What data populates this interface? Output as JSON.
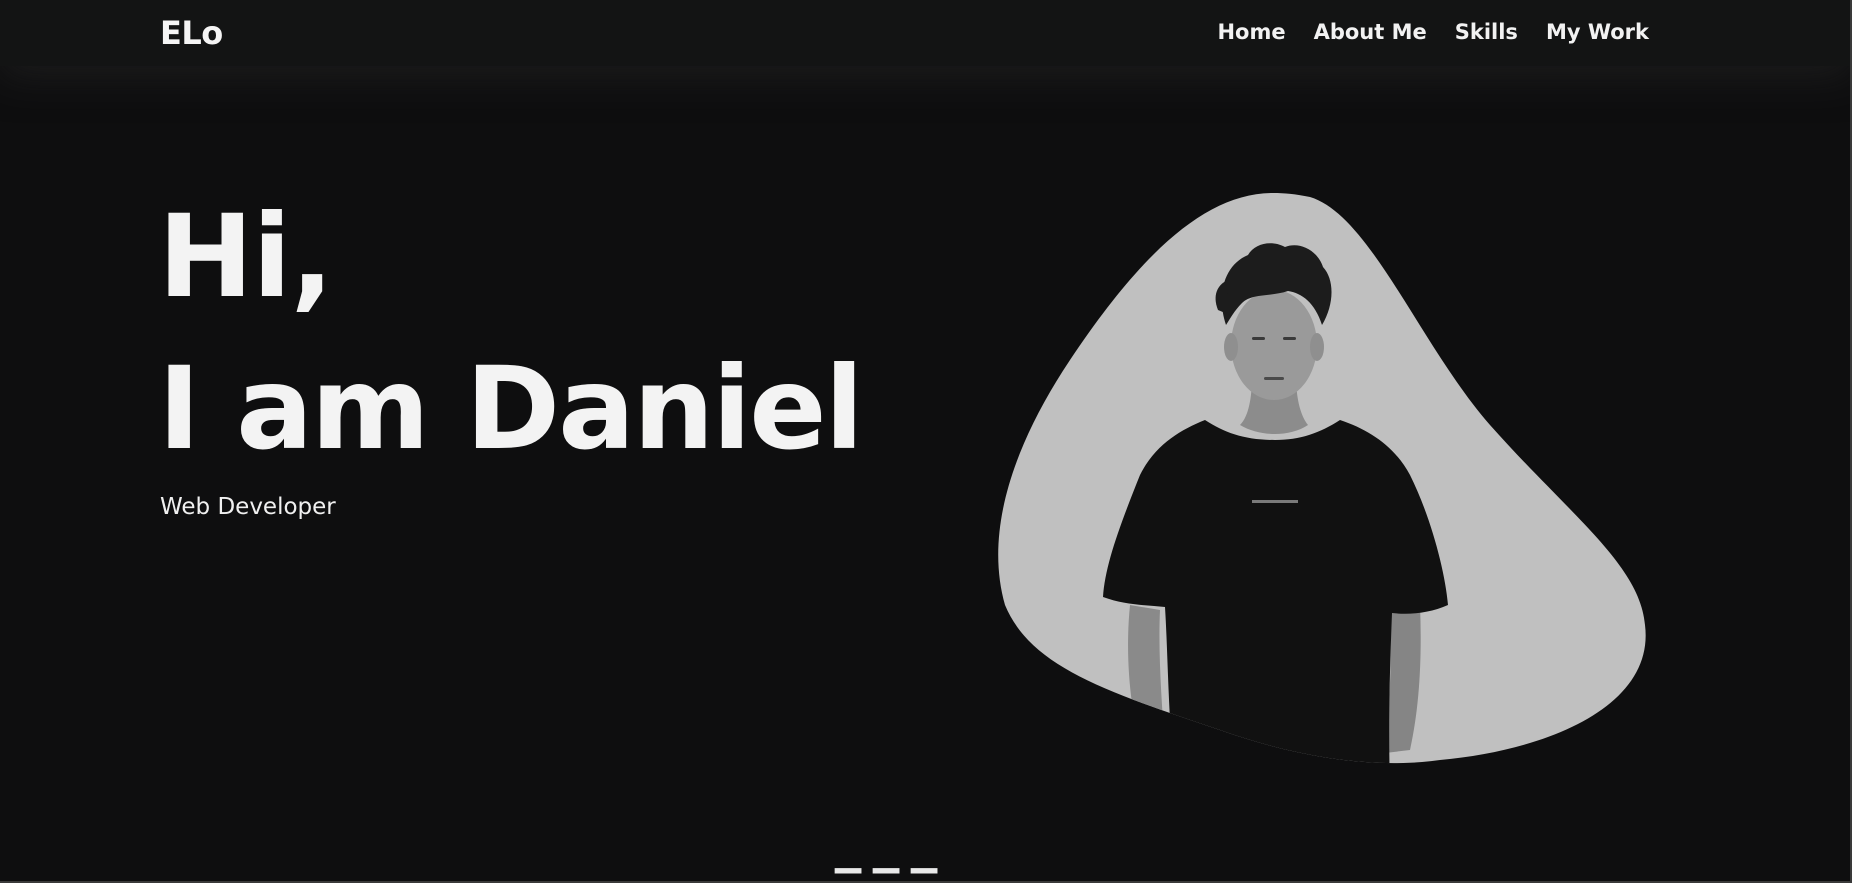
{
  "nav": {
    "logo": "ELo",
    "links": [
      "Home",
      "About Me",
      "Skills",
      "My Work"
    ]
  },
  "hero": {
    "greeting": "Hi,",
    "name_line": "I am Daniel",
    "role": "Web Developer",
    "portrait_icon": "person-portrait-icon"
  },
  "colors": {
    "background": "#0e0e0f",
    "navbar": "#131414",
    "text": "#f3f3f3",
    "blob": "#c0c0c0",
    "shirt": "#111111"
  }
}
